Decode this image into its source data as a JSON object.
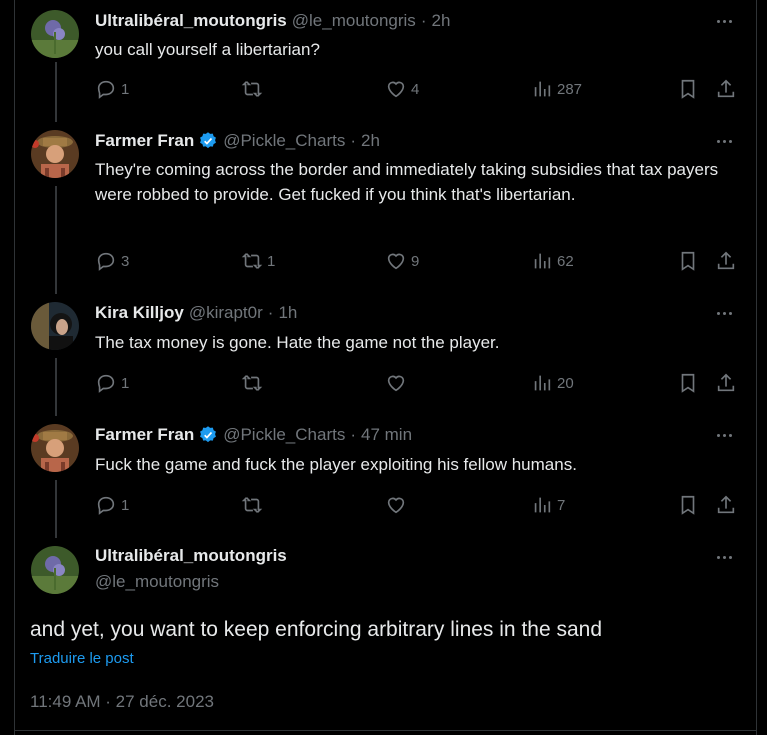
{
  "tweets": [
    {
      "name": "Ultralibéral_moutongris",
      "handle": "@le_moutongris",
      "dot": "·",
      "time": "2h",
      "text": "you call yourself a libertarian?",
      "reply_count": "1",
      "retweet_count": "",
      "like_count": "4",
      "view_count": "287",
      "verified": false
    },
    {
      "name": "Farmer Fran",
      "handle": "@Pickle_Charts",
      "dot": "·",
      "time": "2h",
      "text": "They're coming across the border and immediately taking subsidies that tax payers were robbed to provide. Get fucked if you think that's libertarian.",
      "reply_count": "3",
      "retweet_count": "1",
      "like_count": "9",
      "view_count": "62",
      "verified": true
    },
    {
      "name": "Kira Killjoy",
      "handle": "@kirapt0r",
      "dot": "·",
      "time": "1h",
      "text": "The tax money is gone. Hate the game not the player.",
      "reply_count": "1",
      "retweet_count": "",
      "like_count": "",
      "view_count": "20",
      "verified": false
    },
    {
      "name": "Farmer Fran",
      "handle": "@Pickle_Charts",
      "dot": "·",
      "time": "47 min",
      "text": "Fuck the game and fuck the player exploiting his fellow humans.",
      "reply_count": "1",
      "retweet_count": "",
      "like_count": "",
      "view_count": "7",
      "verified": true
    }
  ],
  "main_tweet": {
    "name": "Ultralibéral_moutongris",
    "handle": "@le_moutongris",
    "text": "and yet, you want to keep enforcing arbitrary lines in the sand",
    "translate_label": "Traduire le post",
    "timestamp": "11:49 AM · 27 déc. 2023"
  },
  "colors": {
    "background": "#000000",
    "text_primary": "#e7e9ea",
    "text_secondary": "#71767b",
    "accent": "#1d9bf0",
    "divider": "#2f3336"
  },
  "icons": {
    "reply": "reply-icon",
    "retweet": "retweet-icon",
    "like": "heart-icon",
    "views": "views-icon",
    "bookmark": "bookmark-icon",
    "share": "share-icon",
    "more": "more-icon",
    "verified": "verified-badge-icon"
  }
}
